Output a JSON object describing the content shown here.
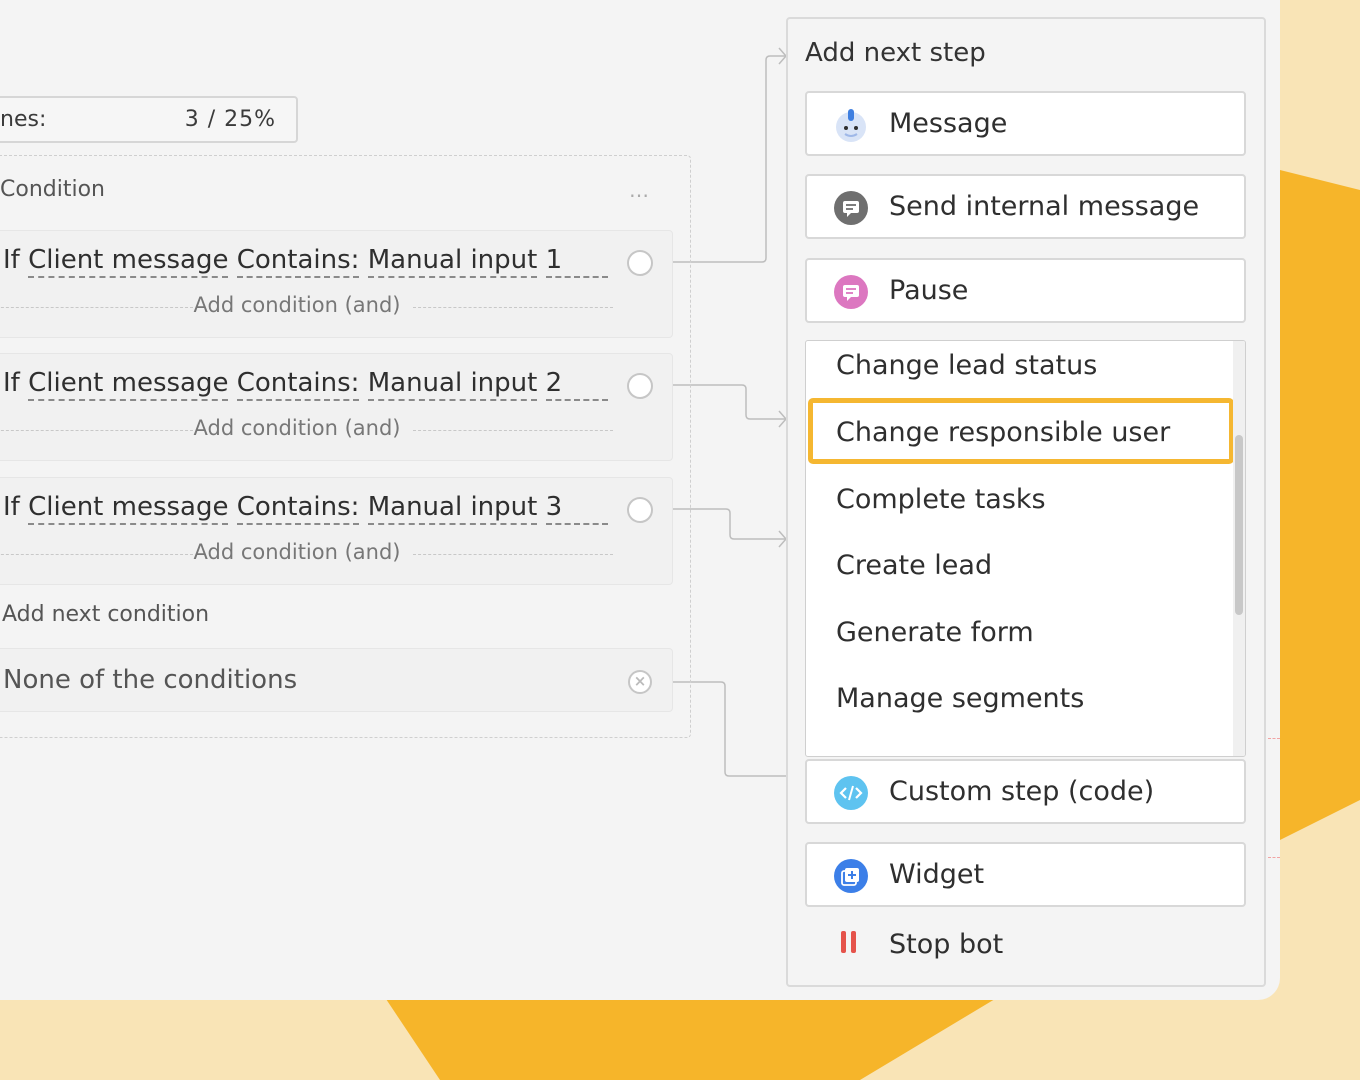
{
  "colors": {
    "background": "#f9e4b6",
    "accent_shape": "#f6b52a",
    "highlight": "#f5b731",
    "canvas": "#f4f4f4"
  },
  "counter": {
    "label": "nes:",
    "value": "3 / 25%"
  },
  "condition_block": {
    "title": "Condition",
    "more_icon": "…",
    "rows": [
      {
        "prefix": "If",
        "field": "Client message",
        "operator": "Contains:",
        "value": "Manual input",
        "number": "1",
        "add_and": "Add condition (and)"
      },
      {
        "prefix": "If",
        "field": "Client message",
        "operator": "Contains:",
        "value": "Manual input",
        "number": "2",
        "add_and": "Add condition (and)"
      },
      {
        "prefix": "If",
        "field": "Client message",
        "operator": "Contains:",
        "value": "Manual input",
        "number": "3",
        "add_and": "Add condition (and)"
      }
    ],
    "add_next_condition": "Add next condition",
    "none": {
      "text": "None of the conditions",
      "icon": "close-circle-icon"
    }
  },
  "panel": {
    "title": "Add next step",
    "steps": [
      {
        "label": "Message",
        "icon": "bot-avatar-icon",
        "icon_color": "#9fb8e8"
      },
      {
        "label": "Send internal message",
        "icon": "chat-bubble-icon",
        "icon_color": "#6f6f6f"
      },
      {
        "label": "Pause",
        "icon": "pause-chat-icon",
        "icon_color": "#dc77c0"
      }
    ],
    "dropdown": {
      "items": [
        "Change lead status",
        "Change responsible user",
        "Complete tasks",
        "Create lead",
        "Generate form",
        "Manage segments"
      ],
      "highlighted": "Change responsible user"
    },
    "custom_step": {
      "label": "Custom step (code)",
      "icon": "code-icon",
      "icon_color": "#5ec3f0"
    },
    "widget": {
      "label": "Widget",
      "icon": "widget-icon",
      "icon_color": "#3c7fe8"
    },
    "stop_bot": {
      "label": "Stop bot",
      "icon": "stop-icon",
      "icon_color": "#e5534b"
    }
  }
}
